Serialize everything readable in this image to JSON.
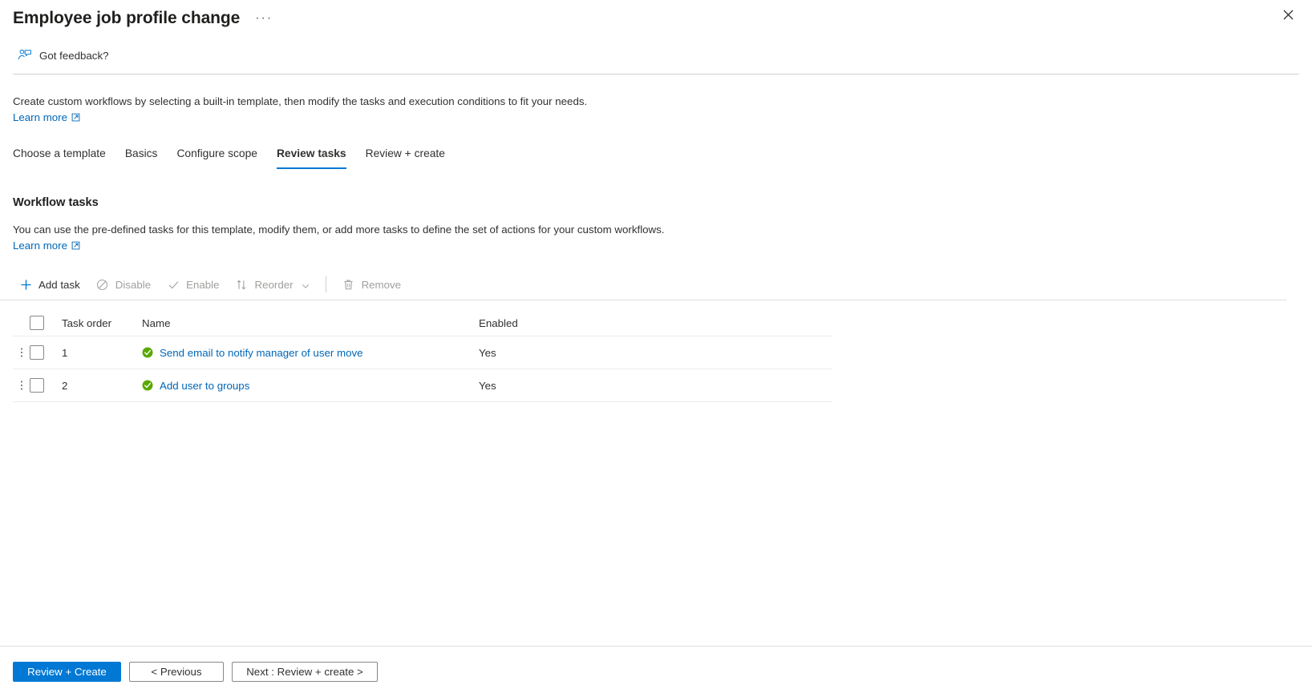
{
  "blade": {
    "title": "Employee job profile change",
    "more_label": "···",
    "close_label": "",
    "feedback_label": "Got feedback?"
  },
  "intro": {
    "text": "Create custom workflows by selecting a built-in template, then modify the tasks and execution conditions to fit your needs.",
    "learn_more": "Learn more"
  },
  "tabs": [
    {
      "label": "Choose a template",
      "active": false
    },
    {
      "label": "Basics",
      "active": false
    },
    {
      "label": "Configure scope",
      "active": false
    },
    {
      "label": "Review tasks",
      "active": true
    },
    {
      "label": "Review + create",
      "active": false
    }
  ],
  "section": {
    "title": "Workflow tasks",
    "description": "You can use the pre-defined tasks for this template, modify them, or add more tasks to define the set of actions for your custom workflows.",
    "learn_more": "Learn more"
  },
  "commandbar": [
    {
      "label": "Add task",
      "icon": "plus-icon",
      "enabled": true
    },
    {
      "label": "Disable",
      "icon": "block-icon",
      "enabled": false
    },
    {
      "label": "Enable",
      "icon": "checkmark-icon",
      "enabled": false
    },
    {
      "label": "Reorder",
      "icon": "sort-arrows-icon",
      "enabled": false,
      "has_chevron": true
    },
    {
      "label": "Remove",
      "icon": "trash-icon",
      "enabled": false
    }
  ],
  "table": {
    "columns": [
      "Task order",
      "Name",
      "Enabled"
    ],
    "rows": [
      {
        "order": "1",
        "name": "Send email to notify manager of user move",
        "enabled": "Yes",
        "status": "success"
      },
      {
        "order": "2",
        "name": "Add user to groups",
        "enabled": "Yes",
        "status": "success"
      }
    ]
  },
  "footer": {
    "primary": "Review + Create",
    "previous": "< Previous",
    "next": "Next : Review + create >"
  },
  "colors": {
    "accent": "#0078d4",
    "link": "#0067b8",
    "success": "#5aa800",
    "text": "#323130",
    "disabled": "#a19f9d",
    "border": "#e1dfdd"
  }
}
